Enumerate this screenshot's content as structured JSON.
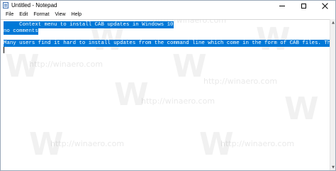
{
  "window": {
    "title": "Untitled - Notepad"
  },
  "menu": {
    "items": [
      "File",
      "Edit",
      "Format",
      "View",
      "Help"
    ]
  },
  "editor": {
    "lines": [
      "     Context menu to install CAB updates in Windows 10",
      "no comments",
      "Many users find it hard to install updates from the command line which come in the form of CAB files. They prefer "
    ]
  },
  "watermark": {
    "logo_letter": "W",
    "text": "http://winaero.com"
  },
  "colors": {
    "selection": "#0078d7",
    "selection_text": "#ffffff"
  }
}
